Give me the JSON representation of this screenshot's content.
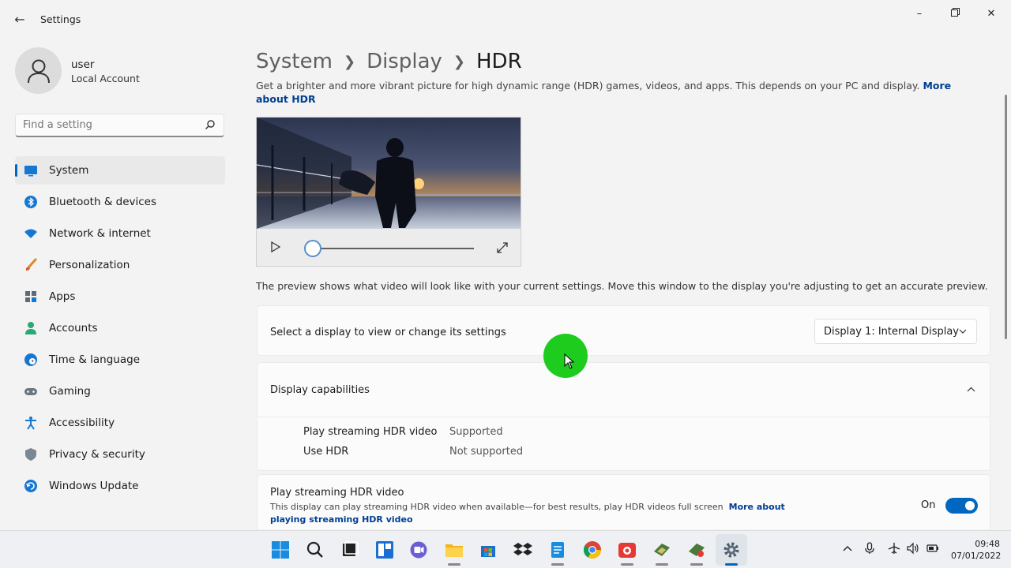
{
  "window": {
    "title": "Settings"
  },
  "user": {
    "name": "user",
    "account_type": "Local Account"
  },
  "search": {
    "placeholder": "Find a setting"
  },
  "sidebar": {
    "items": [
      {
        "label": "System",
        "icon": "monitor-icon",
        "active": true
      },
      {
        "label": "Bluetooth & devices",
        "icon": "bluetooth-icon"
      },
      {
        "label": "Network & internet",
        "icon": "wifi-icon"
      },
      {
        "label": "Personalization",
        "icon": "brush-icon"
      },
      {
        "label": "Apps",
        "icon": "apps-icon"
      },
      {
        "label": "Accounts",
        "icon": "person-icon"
      },
      {
        "label": "Time & language",
        "icon": "globe-clock-icon"
      },
      {
        "label": "Gaming",
        "icon": "gamepad-icon"
      },
      {
        "label": "Accessibility",
        "icon": "accessibility-icon"
      },
      {
        "label": "Privacy & security",
        "icon": "shield-icon"
      },
      {
        "label": "Windows Update",
        "icon": "refresh-icon"
      }
    ]
  },
  "breadcrumb": {
    "part1": "System",
    "part2": "Display",
    "current": "HDR"
  },
  "description": {
    "text": "Get a brighter and more vibrant picture for high dynamic range (HDR) games, videos, and apps. This depends on your PC and display.",
    "link": "More about HDR"
  },
  "video": {
    "progress": 0.0
  },
  "preview_note": "The preview shows what video will look like with your current settings. Move this window to the display you're adjusting to get an accurate preview.",
  "display_select": {
    "label": "Select a display to view or change its settings",
    "value": "Display 1: Internal Display"
  },
  "capabilities": {
    "title": "Display capabilities",
    "rows": [
      {
        "key": "Play streaming HDR video",
        "value": "Supported"
      },
      {
        "key": "Use HDR",
        "value": "Not supported"
      }
    ]
  },
  "streaming": {
    "title": "Play streaming HDR video",
    "desc": "This display can play streaming HDR video when available—for best results, play HDR videos full screen",
    "link": "More about playing streaming HDR video",
    "toggle_label": "On",
    "enabled": true
  },
  "taskbar": {
    "time": "09:48",
    "date": "07/01/2022"
  },
  "colors": {
    "accent": "#0067c0",
    "link": "#003e92",
    "cursor_highlight": "#1ecc1e"
  }
}
